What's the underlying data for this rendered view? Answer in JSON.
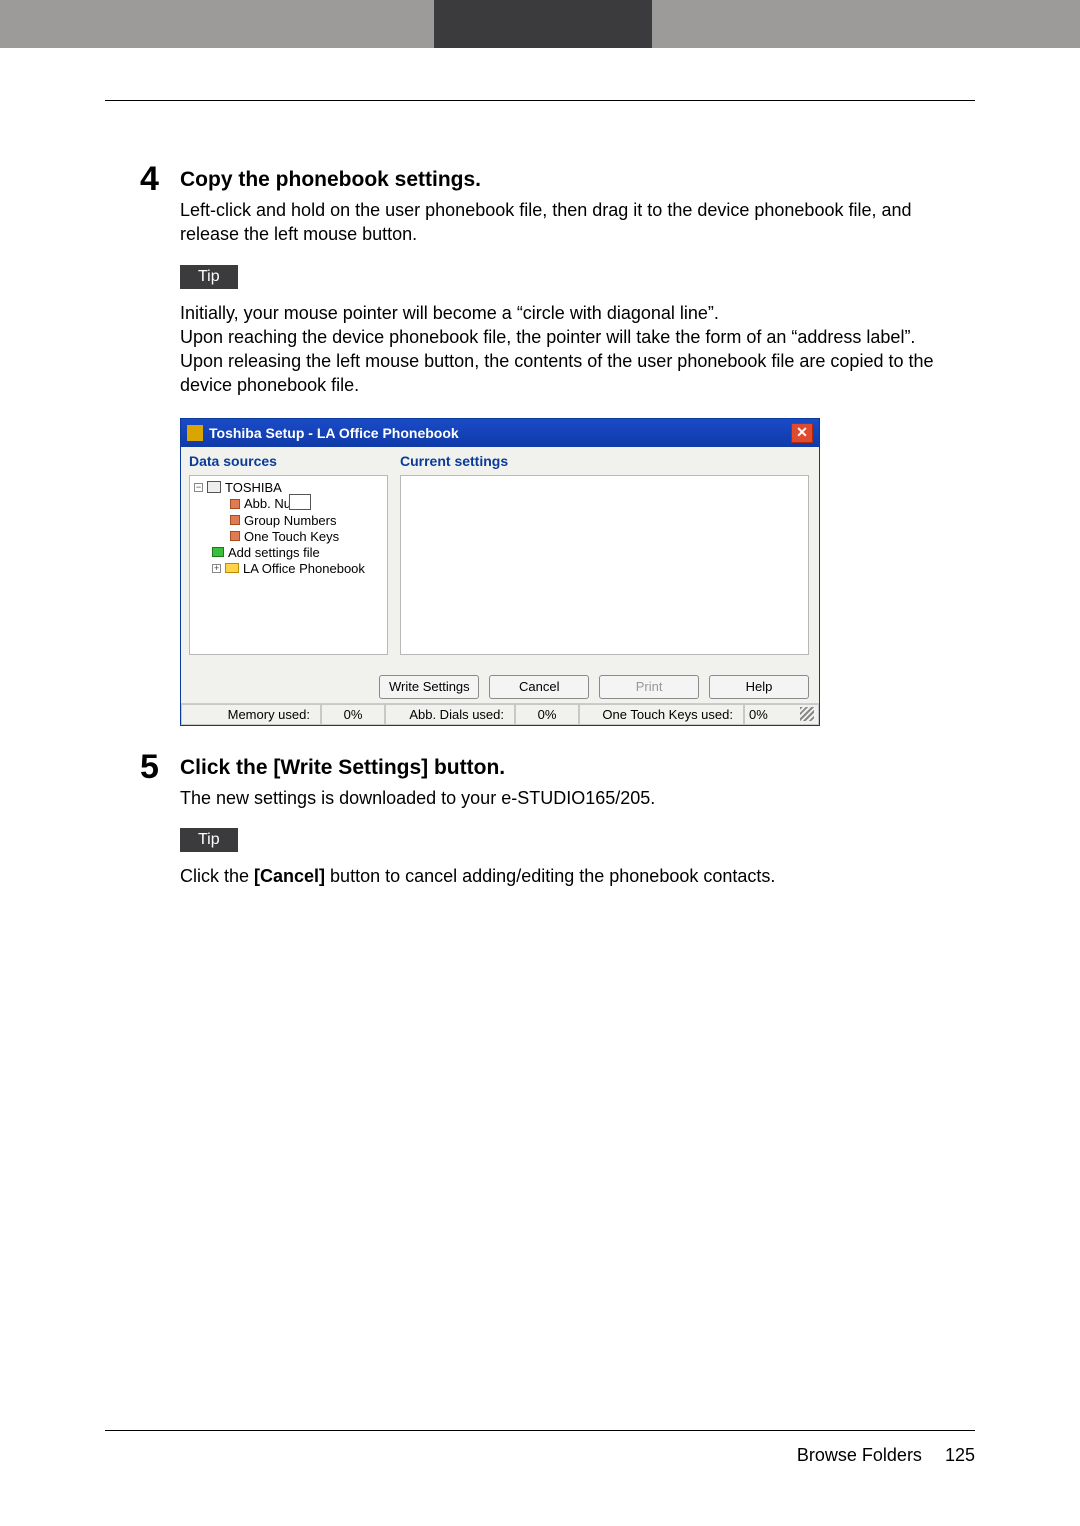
{
  "step4": {
    "number": "4",
    "heading": "Copy the phonebook settings.",
    "body": "Left-click and hold on the user phonebook file, then drag it to the device phonebook file, and release the left mouse button.",
    "tip_label": "Tip",
    "tip_line1": "Initially, your mouse pointer will become a “circle with diagonal line”.",
    "tip_line2": "Upon reaching the device phonebook file, the pointer will take the form of an “address label”.",
    "tip_line3": "Upon releasing the left mouse button, the contents of the user phonebook file are copied to the device phonebook file."
  },
  "window": {
    "title": "Toshiba Setup - LA Office Phonebook",
    "left_heading": "Data sources",
    "right_heading": "Current settings",
    "tree": {
      "root": "TOSHIBA",
      "abb_num": "Abb. Nu",
      "group_numbers": "Group Numbers",
      "one_touch_keys": "One Touch Keys",
      "add_settings": "Add settings file",
      "la_office": "LA Office Phonebook"
    },
    "buttons": {
      "write": "Write Settings",
      "cancel": "Cancel",
      "print": "Print",
      "help": "Help"
    },
    "status": {
      "mem_label": "Memory used:",
      "mem_val": "0%",
      "abb_label": "Abb. Dials used:",
      "abb_val": "0%",
      "one_label": "One Touch Keys used:",
      "one_val": "0%"
    }
  },
  "step5": {
    "number": "5",
    "heading": "Click the [Write Settings] button.",
    "body": "The new settings is downloaded to your e-STUDIO165/205.",
    "tip_label": "Tip",
    "tip_text_prefix": "Click the ",
    "tip_text_bold": "[Cancel]",
    "tip_text_suffix": " button to cancel adding/editing the phonebook contacts."
  },
  "footer": {
    "section": "Browse Folders",
    "page": "125"
  }
}
